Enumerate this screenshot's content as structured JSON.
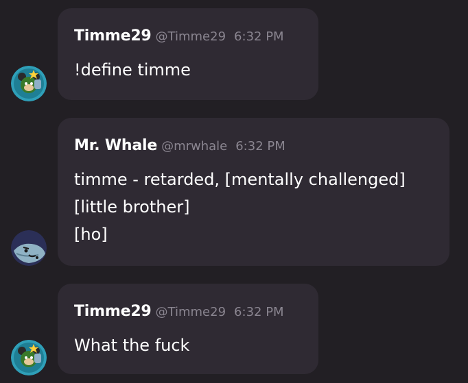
{
  "messages": [
    {
      "author": "Timme29",
      "handle": "@Timme29",
      "time": "6:32 PM",
      "lines": [
        "!define timme"
      ],
      "avatar_icon": "mickey-avatar-icon"
    },
    {
      "author": "Mr. Whale",
      "handle": "@mrwhale",
      "time": "6:32 PM",
      "lines": [
        "timme - retarded, [mentally challenged]",
        "[little brother]",
        "[ho]"
      ],
      "avatar_icon": "whale-avatar-icon"
    },
    {
      "author": "Timme29",
      "handle": "@Timme29",
      "time": "6:32 PM",
      "lines": [
        "What the fuck"
      ],
      "avatar_icon": "mickey-avatar-icon"
    }
  ],
  "colors": {
    "background": "#221f24",
    "bubble": "#2f2a33",
    "text": "#ffffff",
    "muted": "#8a8590",
    "avatar_ring_teal": "#3aa0b8"
  }
}
